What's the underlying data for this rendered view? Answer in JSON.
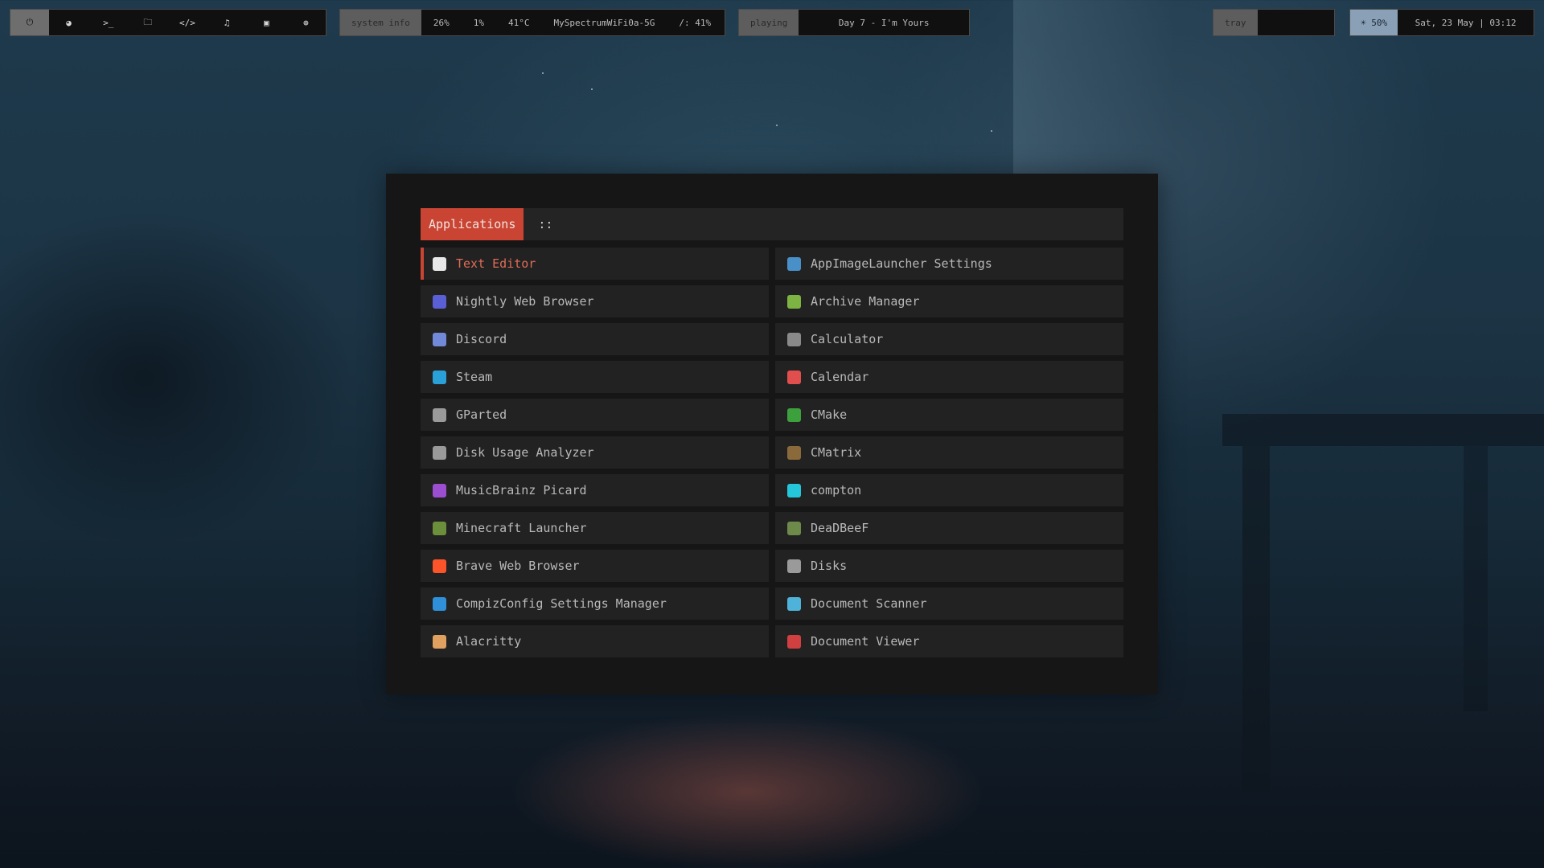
{
  "topbar": {
    "launchers": [
      {
        "icon": "power-icon",
        "glyph": "⏻"
      },
      {
        "icon": "browser-icon",
        "glyph": "◕"
      },
      {
        "icon": "terminal-icon",
        "glyph": ">_"
      },
      {
        "icon": "folder-icon",
        "glyph": "🗀"
      },
      {
        "icon": "code-icon",
        "glyph": "</>"
      },
      {
        "icon": "music-icon",
        "glyph": "♫"
      },
      {
        "icon": "chat-icon",
        "glyph": "▣"
      },
      {
        "icon": "steam-icon",
        "glyph": "⊛"
      }
    ],
    "system": {
      "label": "system info",
      "cpu": "26%",
      "mem": "1%",
      "temp": "41°C",
      "wifi": "MySpectrumWiFi0a-5G",
      "disk": "/: 41%"
    },
    "media": {
      "label": "playing",
      "track": "Day 7 - I'm Yours"
    },
    "tray": {
      "label": "tray"
    },
    "brightness": "☀ 50%",
    "datetime": "Sat, 23 May | 03:12"
  },
  "launcher": {
    "mode": "Applications",
    "separator": "::",
    "columns": [
      [
        {
          "label": "Text Editor",
          "icon": "text-editor-icon",
          "color": "#e8e8e8",
          "selected": true
        },
        {
          "label": "Nightly Web Browser",
          "icon": "firefox-nightly-icon",
          "color": "#5b5fd6"
        },
        {
          "label": "Discord",
          "icon": "discord-icon",
          "color": "#7289da"
        },
        {
          "label": "Steam",
          "icon": "steam-icon",
          "color": "#2aa0d8"
        },
        {
          "label": "GParted",
          "icon": "gparted-icon",
          "color": "#9a9a9a"
        },
        {
          "label": "Disk Usage Analyzer",
          "icon": "disk-usage-icon",
          "color": "#9a9a9a"
        },
        {
          "label": "MusicBrainz Picard",
          "icon": "picard-icon",
          "color": "#9b4fd0"
        },
        {
          "label": "Minecraft Launcher",
          "icon": "minecraft-icon",
          "color": "#6b8f3a"
        },
        {
          "label": "Brave Web Browser",
          "icon": "brave-icon",
          "color": "#fb542b"
        },
        {
          "label": "CompizConfig Settings Manager",
          "icon": "compiz-icon",
          "color": "#2f8fd8"
        },
        {
          "label": "Alacritty",
          "icon": "alacritty-icon",
          "color": "#e0a060"
        }
      ],
      [
        {
          "label": "AppImageLauncher Settings",
          "icon": "appimage-icon",
          "color": "#4a90c8"
        },
        {
          "label": "Archive Manager",
          "icon": "archive-icon",
          "color": "#7cb342"
        },
        {
          "label": "Calculator",
          "icon": "calculator-icon",
          "color": "#8a8a8a"
        },
        {
          "label": "Calendar",
          "icon": "calendar-icon",
          "color": "#e04e4e"
        },
        {
          "label": "CMake",
          "icon": "cmake-icon",
          "color": "#3ca03c"
        },
        {
          "label": "CMatrix",
          "icon": "cmatrix-icon",
          "color": "#8a6a3a"
        },
        {
          "label": "compton",
          "icon": "compton-icon",
          "color": "#26c6da"
        },
        {
          "label": "DeaDBeeF",
          "icon": "deadbeef-icon",
          "color": "#6d8a4a"
        },
        {
          "label": "Disks",
          "icon": "disks-icon",
          "color": "#9a9a9a"
        },
        {
          "label": "Document Scanner",
          "icon": "scanner-icon",
          "color": "#4fb3d9"
        },
        {
          "label": "Document Viewer",
          "icon": "document-viewer-icon",
          "color": "#d04040"
        }
      ]
    ]
  }
}
